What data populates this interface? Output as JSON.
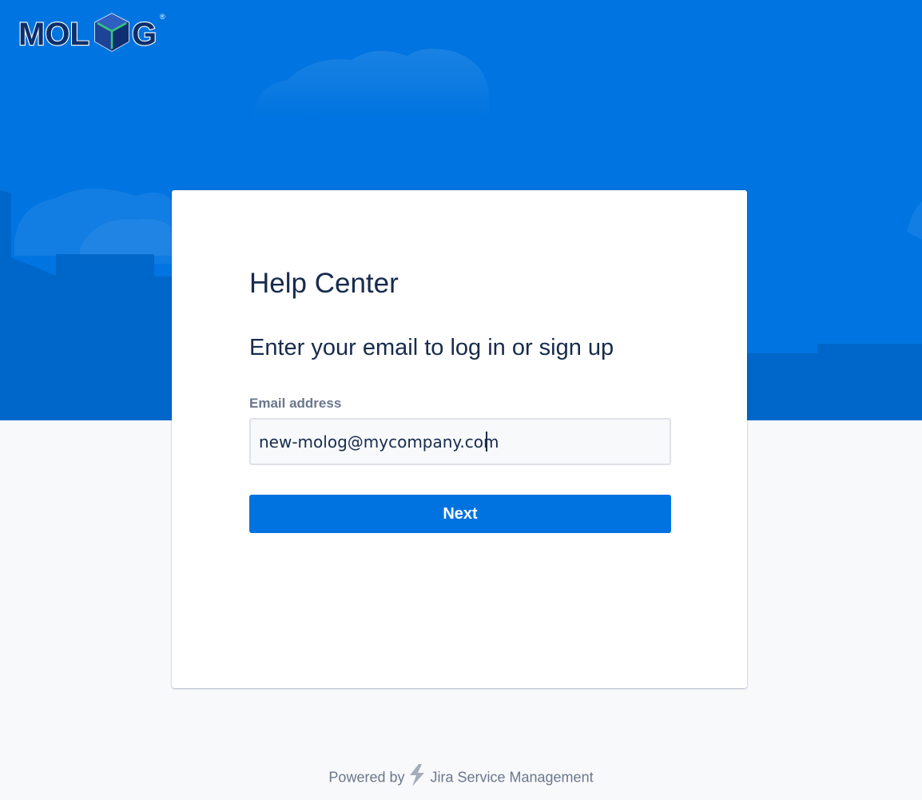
{
  "brand": {
    "logo_text": "MOLOG",
    "registered_mark": "®"
  },
  "card": {
    "title": "Help Center",
    "subtitle": "Enter your email to log in or sign up",
    "email_label": "Email address",
    "email_value": "new-molog@mycompany.com",
    "next_label": "Next"
  },
  "footer": {
    "powered_by": "Powered by",
    "product": "Jira Service Management"
  },
  "colors": {
    "hero": "#0074e0",
    "accent": "#0073e0",
    "text": "#172b4d",
    "muted": "#6b778c"
  },
  "icons": {
    "logo": "molog-cube-logo",
    "footer": "jira-bolt-icon"
  }
}
